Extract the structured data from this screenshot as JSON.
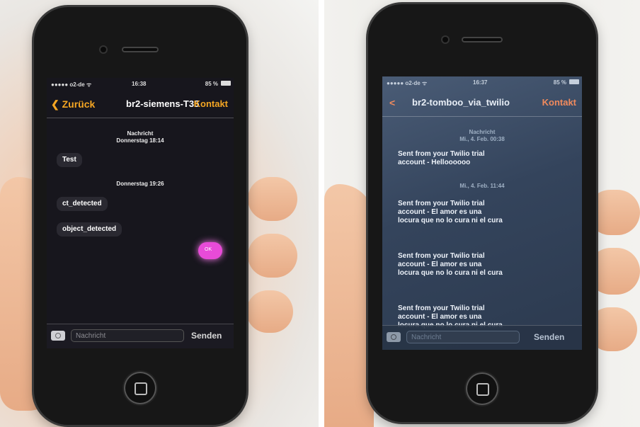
{
  "left_phone": {
    "status": {
      "carrier": "●●●●● o2-de ᯤ",
      "time": "16:38",
      "battery": "85 %"
    },
    "nav": {
      "back_label": "Zurück",
      "title": "br2-siemens-T35",
      "action_label": "Kontakt"
    },
    "thread": [
      {
        "kind": "meta",
        "text": "Nachricht"
      },
      {
        "kind": "meta",
        "text": "Donnerstag 18:14"
      },
      {
        "kind": "message",
        "text": "Test"
      },
      {
        "kind": "meta",
        "text": "Donnerstag 19:26"
      },
      {
        "kind": "message",
        "text": "ct_detected"
      },
      {
        "kind": "message",
        "text": "object_detected"
      },
      {
        "kind": "sent",
        "text": "OK"
      }
    ],
    "input": {
      "placeholder": "Nachricht",
      "send_label": "Senden"
    }
  },
  "right_phone": {
    "status": {
      "carrier": "●●●●● o2-de ᯤ",
      "time": "16:37",
      "battery": "85 %"
    },
    "nav": {
      "back_label": "<",
      "title": "br2-tomboo_via_twilio",
      "action_label": "Kontakt"
    },
    "thread": [
      {
        "kind": "meta",
        "text": "Nachricht"
      },
      {
        "kind": "meta",
        "text": "Mi., 4. Feb. 00:38"
      },
      {
        "kind": "message",
        "text": "Sent from your Twilio trial account - Helloooooo"
      },
      {
        "kind": "meta",
        "text": "Mi., 4. Feb. 11:44"
      },
      {
        "kind": "message",
        "text": "Sent from your Twilio trial account - El amor es una locura que no lo cura ni el cura"
      },
      {
        "kind": "message",
        "text": "Sent from your Twilio trial account - El amor es una locura que no lo cura ni el cura"
      },
      {
        "kind": "message",
        "text": "Sent from your Twilio trial account - El amor es una locura que no lo cura ni el cura"
      }
    ],
    "input": {
      "placeholder": "Nachricht",
      "send_label": "Senden"
    }
  },
  "colors": {
    "accent_orange": "#f5a623",
    "kontakt_salmon": "#f08a5d",
    "ok_bubble": "#e84bd8",
    "left_screen_bg": "#17161d",
    "right_screen_bg": "#3a4b63"
  }
}
